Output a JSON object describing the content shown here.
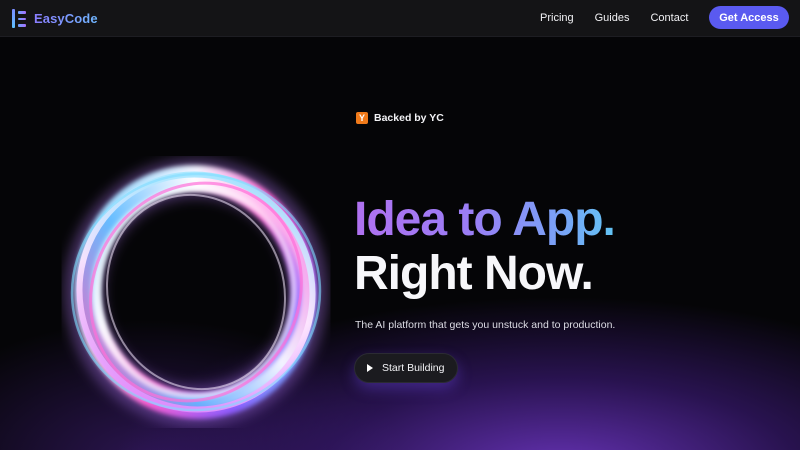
{
  "brand": {
    "name": "EasyCode",
    "icon": "easycode-logo-icon"
  },
  "nav": {
    "links": [
      "Pricing",
      "Guides",
      "Contact"
    ],
    "cta": "Get Access"
  },
  "hero": {
    "badge": {
      "icon": "yc-logo-icon",
      "glyph": "Y",
      "text": "Backed by YC"
    },
    "headline_line1": "Idea to App.",
    "headline_line2": "Right Now.",
    "subtitle": "The AI platform that gets you unstuck and to production.",
    "cta": {
      "label": "Start Building",
      "icon": "play-icon"
    }
  },
  "colors": {
    "accent": "#5a5af0",
    "yc_orange": "#f07a1a",
    "gradient_start": "#b071f0",
    "gradient_end": "#62c4f4"
  }
}
